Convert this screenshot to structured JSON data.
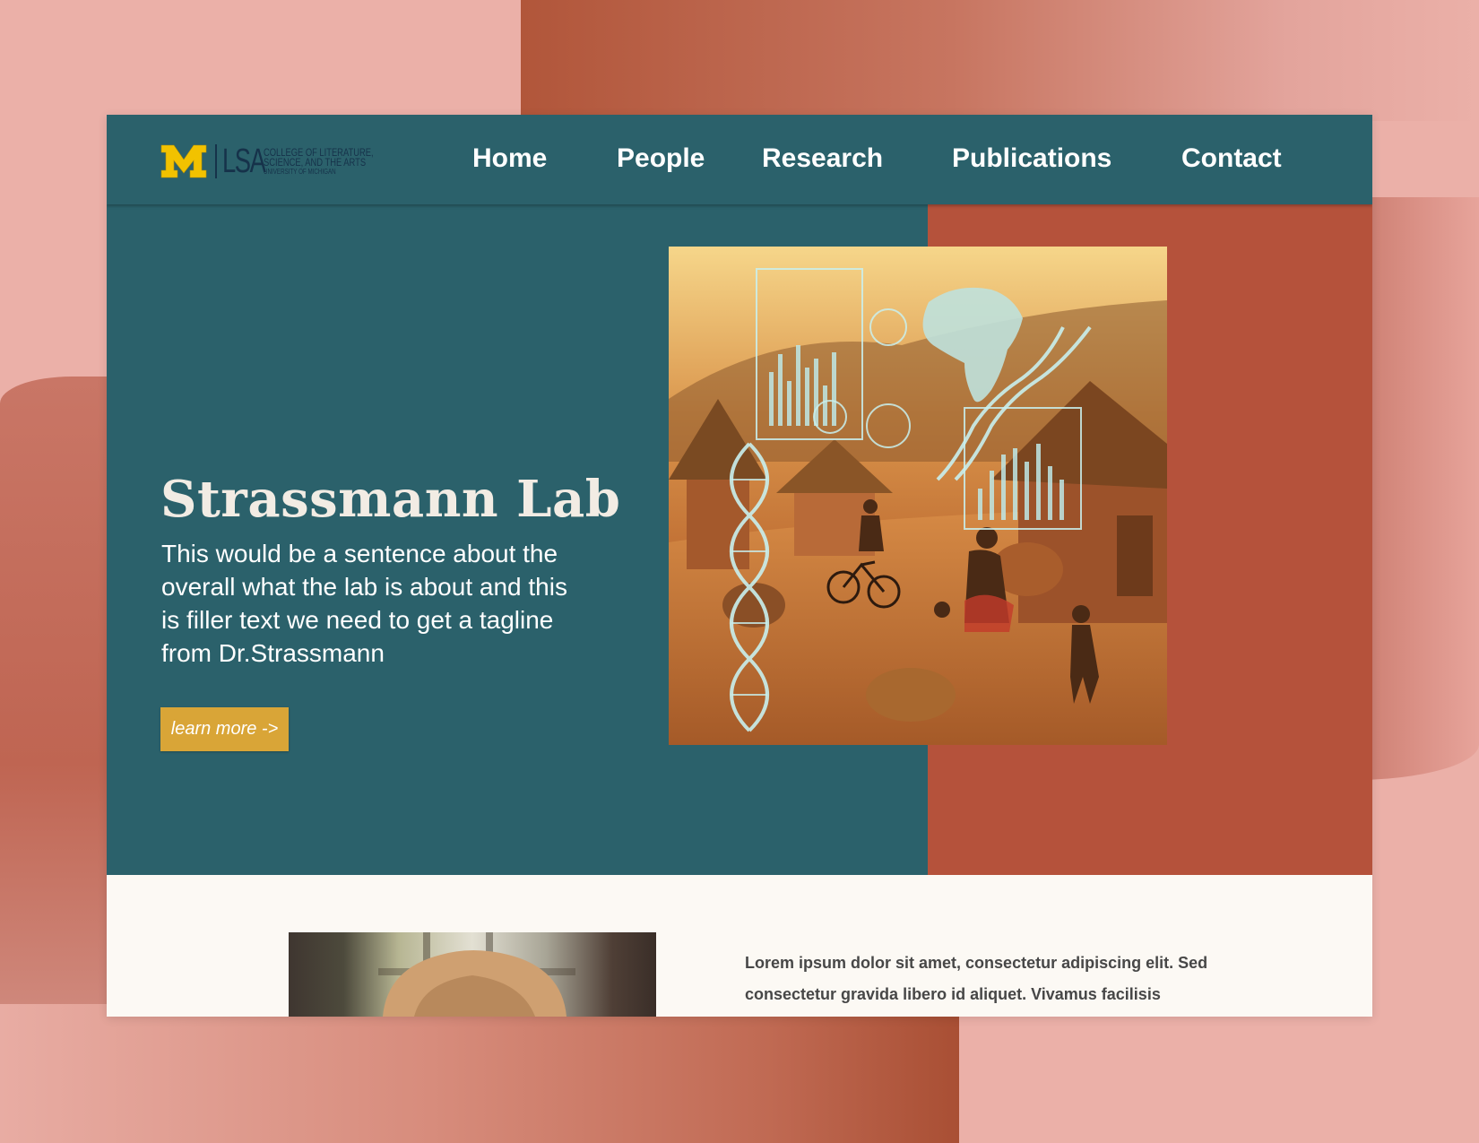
{
  "logo": {
    "mark": "M",
    "unit": "LSA",
    "college_lines": [
      "COLLEGE OF LITERATURE,",
      "SCIENCE, AND THE ARTS",
      "UNIVERSITY OF MICHIGAN"
    ]
  },
  "nav": {
    "items": [
      "Home",
      "People",
      "Research",
      "Publications",
      "Contact"
    ]
  },
  "hero": {
    "title": "Strassmann Lab",
    "tagline": "This would be a sentence about the overall what the lab is about and this is filler text we need to get a tagline from Dr.Strassmann",
    "button_label": "learn more ->",
    "image_icon": "dna-village-illustration"
  },
  "about": {
    "portrait_icon": "portrait-photo",
    "text": "Lorem ipsum dolor sit amet, consectetur adipiscing elit. Sed consectetur gravida libero id aliquet. Vivamus facilisis mollis risus eget sodales. Cras rutrum neque vitae lorem luctus lobortis. Mauris ut massa ac erat pretium pellentesque sit"
  },
  "colors": {
    "nav_bg": "#2b616b",
    "hero_accent": "#b5523b",
    "button": "#d9a537",
    "page_bg": "#ebb0a8",
    "umich_maize": "#f2c200",
    "umich_blue": "#16324a"
  }
}
